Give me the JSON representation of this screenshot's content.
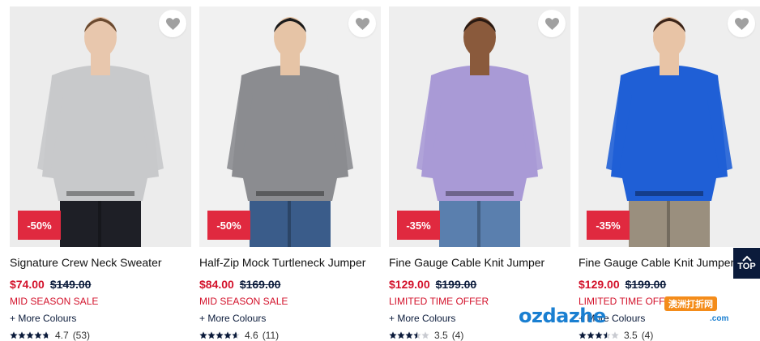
{
  "products": [
    {
      "name": "Signature Crew Neck Sweater",
      "price": "$74.00",
      "original_price": "$149.00",
      "promo": "MID SEASON SALE",
      "discount": "-50%",
      "more_colours": "+ More Colours",
      "rating": "4.7",
      "rating_value": 4.7,
      "reviews": "(53)",
      "sweater_color": "#c8c9cb",
      "pants_color": "#1e1f26",
      "bg_color": "#ececec",
      "skin": "#e8c7ad",
      "hair": "#6b4a30"
    },
    {
      "name": "Half-Zip Mock Turtleneck Jumper",
      "price": "$84.00",
      "original_price": "$169.00",
      "promo": "MID SEASON SALE",
      "discount": "-50%",
      "more_colours": "+ More Colours",
      "rating": "4.6",
      "rating_value": 4.6,
      "reviews": "(11)",
      "sweater_color": "#8b8c90",
      "pants_color": "#3a5c8a",
      "bg_color": "#f1f1f1",
      "skin": "#e6c4a6",
      "hair": "#1b1b1b"
    },
    {
      "name": "Fine Gauge Cable Knit Jumper",
      "price": "$129.00",
      "original_price": "$199.00",
      "promo": "LIMITED TIME OFFER",
      "discount": "-35%",
      "more_colours": "+ More Colours",
      "rating": "3.5",
      "rating_value": 3.5,
      "reviews": "(4)",
      "sweater_color": "#a99ad6",
      "pants_color": "#5a7fae",
      "bg_color": "#eeeeee",
      "skin": "#8a5a3c",
      "hair": "#2a1a12"
    },
    {
      "name": "Fine Gauge Cable Knit Jumper",
      "price": "$129.00",
      "original_price": "$199.00",
      "promo": "LIMITED TIME OFFER",
      "discount": "-35%",
      "more_colours": "+ More Colours",
      "rating": "3.5",
      "rating_value": 3.5,
      "reviews": "(4)",
      "sweater_color": "#1f5fd6",
      "pants_color": "#9a8f7e",
      "bg_color": "#eeeeee",
      "skin": "#e8c4a6",
      "hair": "#3b2418"
    }
  ],
  "back_to_top": {
    "label": "TOP"
  },
  "watermark": {
    "tag": "澳洲打折网",
    "text": "ozdazhe",
    "domain": ".com"
  },
  "colors": {
    "sale_red": "#d3122b",
    "badge_red": "#e0293f",
    "navy": "#0b1b3b"
  },
  "icons": {
    "wishlist": "heart-icon",
    "rating": "star-icon",
    "top": "chevron-up-icon"
  }
}
